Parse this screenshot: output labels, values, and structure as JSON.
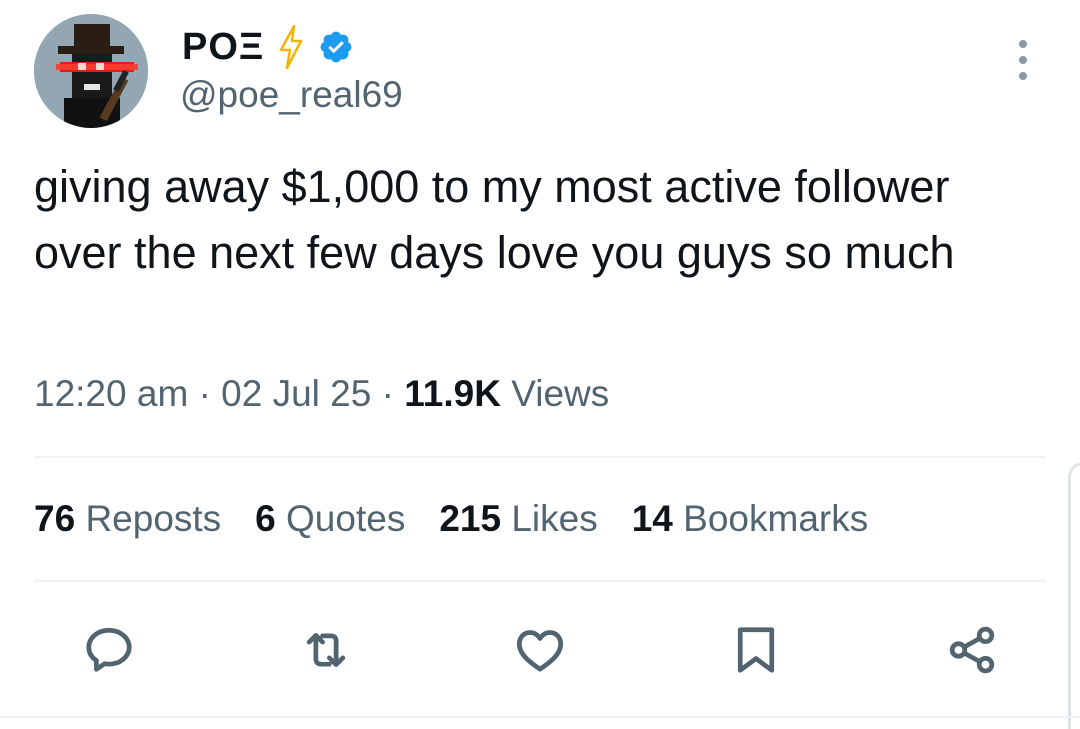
{
  "author": {
    "display_name": "POΞ",
    "handle": "@poe_real69",
    "avatar_icon": "pixel-hat-gunman-avatar",
    "verified": true,
    "verified_color": "#1d9bf0",
    "bolt_color": "#f4b400"
  },
  "tweet": {
    "text": "giving away $1,000 to my most active follower over the next few days love you guys so much",
    "time": "12:20 am",
    "date": "02 Jul 25",
    "views_count": "11.9K",
    "views_label": "Views"
  },
  "stats": [
    {
      "count": "76",
      "label": "Reposts"
    },
    {
      "count": "6",
      "label": "Quotes"
    },
    {
      "count": "215",
      "label": "Likes"
    },
    {
      "count": "14",
      "label": "Bookmarks"
    }
  ],
  "actions": [
    "reply-icon",
    "repost-icon",
    "like-icon",
    "bookmark-icon",
    "share-icon"
  ],
  "colors": {
    "text_primary": "#0f1419",
    "text_secondary": "#536471",
    "divider": "#eff3f4"
  }
}
